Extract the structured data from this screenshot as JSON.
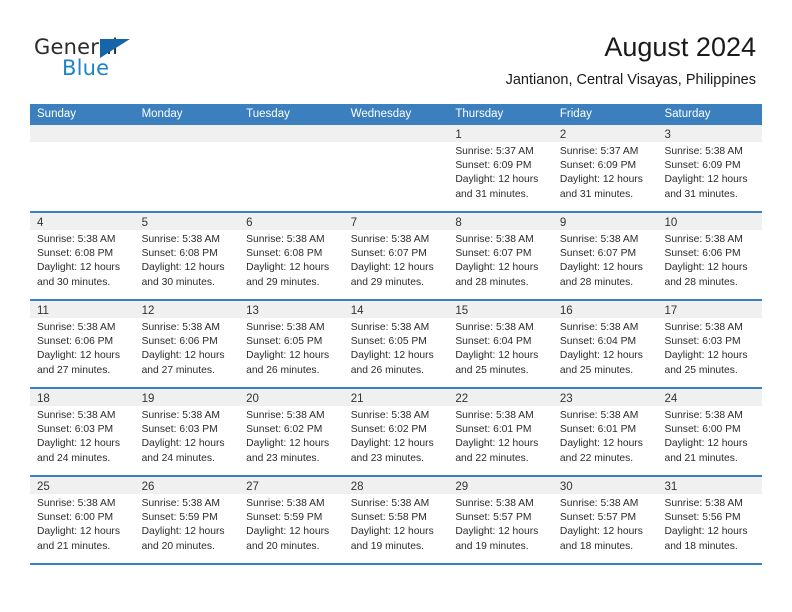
{
  "brand": {
    "name_part1": "General",
    "name_part2": "Blue",
    "triangle_color": "#1565a8",
    "blue_text_color": "#2083c8"
  },
  "header": {
    "title": "August 2024",
    "subtitle": "Jantianon, Central Visayas, Philippines"
  },
  "theme": {
    "header_row_bg": "#3b7fbf",
    "header_row_text": "#ffffff",
    "day_band_bg": "#f0f0f0",
    "week_divider": "#3b7fbf",
    "cell_bg": "#ffffff",
    "body_text": "#2b2b2b"
  },
  "weekdays": [
    "Sunday",
    "Monday",
    "Tuesday",
    "Wednesday",
    "Thursday",
    "Friday",
    "Saturday"
  ],
  "weeks": [
    [
      {
        "day": "",
        "sunrise": "",
        "sunset": "",
        "daylight_line1": "",
        "daylight_line2": ""
      },
      {
        "day": "",
        "sunrise": "",
        "sunset": "",
        "daylight_line1": "",
        "daylight_line2": ""
      },
      {
        "day": "",
        "sunrise": "",
        "sunset": "",
        "daylight_line1": "",
        "daylight_line2": ""
      },
      {
        "day": "",
        "sunrise": "",
        "sunset": "",
        "daylight_line1": "",
        "daylight_line2": ""
      },
      {
        "day": "1",
        "sunrise": "Sunrise: 5:37 AM",
        "sunset": "Sunset: 6:09 PM",
        "daylight_line1": "Daylight: 12 hours",
        "daylight_line2": "and 31 minutes."
      },
      {
        "day": "2",
        "sunrise": "Sunrise: 5:37 AM",
        "sunset": "Sunset: 6:09 PM",
        "daylight_line1": "Daylight: 12 hours",
        "daylight_line2": "and 31 minutes."
      },
      {
        "day": "3",
        "sunrise": "Sunrise: 5:38 AM",
        "sunset": "Sunset: 6:09 PM",
        "daylight_line1": "Daylight: 12 hours",
        "daylight_line2": "and 31 minutes."
      }
    ],
    [
      {
        "day": "4",
        "sunrise": "Sunrise: 5:38 AM",
        "sunset": "Sunset: 6:08 PM",
        "daylight_line1": "Daylight: 12 hours",
        "daylight_line2": "and 30 minutes."
      },
      {
        "day": "5",
        "sunrise": "Sunrise: 5:38 AM",
        "sunset": "Sunset: 6:08 PM",
        "daylight_line1": "Daylight: 12 hours",
        "daylight_line2": "and 30 minutes."
      },
      {
        "day": "6",
        "sunrise": "Sunrise: 5:38 AM",
        "sunset": "Sunset: 6:08 PM",
        "daylight_line1": "Daylight: 12 hours",
        "daylight_line2": "and 29 minutes."
      },
      {
        "day": "7",
        "sunrise": "Sunrise: 5:38 AM",
        "sunset": "Sunset: 6:07 PM",
        "daylight_line1": "Daylight: 12 hours",
        "daylight_line2": "and 29 minutes."
      },
      {
        "day": "8",
        "sunrise": "Sunrise: 5:38 AM",
        "sunset": "Sunset: 6:07 PM",
        "daylight_line1": "Daylight: 12 hours",
        "daylight_line2": "and 28 minutes."
      },
      {
        "day": "9",
        "sunrise": "Sunrise: 5:38 AM",
        "sunset": "Sunset: 6:07 PM",
        "daylight_line1": "Daylight: 12 hours",
        "daylight_line2": "and 28 minutes."
      },
      {
        "day": "10",
        "sunrise": "Sunrise: 5:38 AM",
        "sunset": "Sunset: 6:06 PM",
        "daylight_line1": "Daylight: 12 hours",
        "daylight_line2": "and 28 minutes."
      }
    ],
    [
      {
        "day": "11",
        "sunrise": "Sunrise: 5:38 AM",
        "sunset": "Sunset: 6:06 PM",
        "daylight_line1": "Daylight: 12 hours",
        "daylight_line2": "and 27 minutes."
      },
      {
        "day": "12",
        "sunrise": "Sunrise: 5:38 AM",
        "sunset": "Sunset: 6:06 PM",
        "daylight_line1": "Daylight: 12 hours",
        "daylight_line2": "and 27 minutes."
      },
      {
        "day": "13",
        "sunrise": "Sunrise: 5:38 AM",
        "sunset": "Sunset: 6:05 PM",
        "daylight_line1": "Daylight: 12 hours",
        "daylight_line2": "and 26 minutes."
      },
      {
        "day": "14",
        "sunrise": "Sunrise: 5:38 AM",
        "sunset": "Sunset: 6:05 PM",
        "daylight_line1": "Daylight: 12 hours",
        "daylight_line2": "and 26 minutes."
      },
      {
        "day": "15",
        "sunrise": "Sunrise: 5:38 AM",
        "sunset": "Sunset: 6:04 PM",
        "daylight_line1": "Daylight: 12 hours",
        "daylight_line2": "and 25 minutes."
      },
      {
        "day": "16",
        "sunrise": "Sunrise: 5:38 AM",
        "sunset": "Sunset: 6:04 PM",
        "daylight_line1": "Daylight: 12 hours",
        "daylight_line2": "and 25 minutes."
      },
      {
        "day": "17",
        "sunrise": "Sunrise: 5:38 AM",
        "sunset": "Sunset: 6:03 PM",
        "daylight_line1": "Daylight: 12 hours",
        "daylight_line2": "and 25 minutes."
      }
    ],
    [
      {
        "day": "18",
        "sunrise": "Sunrise: 5:38 AM",
        "sunset": "Sunset: 6:03 PM",
        "daylight_line1": "Daylight: 12 hours",
        "daylight_line2": "and 24 minutes."
      },
      {
        "day": "19",
        "sunrise": "Sunrise: 5:38 AM",
        "sunset": "Sunset: 6:03 PM",
        "daylight_line1": "Daylight: 12 hours",
        "daylight_line2": "and 24 minutes."
      },
      {
        "day": "20",
        "sunrise": "Sunrise: 5:38 AM",
        "sunset": "Sunset: 6:02 PM",
        "daylight_line1": "Daylight: 12 hours",
        "daylight_line2": "and 23 minutes."
      },
      {
        "day": "21",
        "sunrise": "Sunrise: 5:38 AM",
        "sunset": "Sunset: 6:02 PM",
        "daylight_line1": "Daylight: 12 hours",
        "daylight_line2": "and 23 minutes."
      },
      {
        "day": "22",
        "sunrise": "Sunrise: 5:38 AM",
        "sunset": "Sunset: 6:01 PM",
        "daylight_line1": "Daylight: 12 hours",
        "daylight_line2": "and 22 minutes."
      },
      {
        "day": "23",
        "sunrise": "Sunrise: 5:38 AM",
        "sunset": "Sunset: 6:01 PM",
        "daylight_line1": "Daylight: 12 hours",
        "daylight_line2": "and 22 minutes."
      },
      {
        "day": "24",
        "sunrise": "Sunrise: 5:38 AM",
        "sunset": "Sunset: 6:00 PM",
        "daylight_line1": "Daylight: 12 hours",
        "daylight_line2": "and 21 minutes."
      }
    ],
    [
      {
        "day": "25",
        "sunrise": "Sunrise: 5:38 AM",
        "sunset": "Sunset: 6:00 PM",
        "daylight_line1": "Daylight: 12 hours",
        "daylight_line2": "and 21 minutes."
      },
      {
        "day": "26",
        "sunrise": "Sunrise: 5:38 AM",
        "sunset": "Sunset: 5:59 PM",
        "daylight_line1": "Daylight: 12 hours",
        "daylight_line2": "and 20 minutes."
      },
      {
        "day": "27",
        "sunrise": "Sunrise: 5:38 AM",
        "sunset": "Sunset: 5:59 PM",
        "daylight_line1": "Daylight: 12 hours",
        "daylight_line2": "and 20 minutes."
      },
      {
        "day": "28",
        "sunrise": "Sunrise: 5:38 AM",
        "sunset": "Sunset: 5:58 PM",
        "daylight_line1": "Daylight: 12 hours",
        "daylight_line2": "and 19 minutes."
      },
      {
        "day": "29",
        "sunrise": "Sunrise: 5:38 AM",
        "sunset": "Sunset: 5:57 PM",
        "daylight_line1": "Daylight: 12 hours",
        "daylight_line2": "and 19 minutes."
      },
      {
        "day": "30",
        "sunrise": "Sunrise: 5:38 AM",
        "sunset": "Sunset: 5:57 PM",
        "daylight_line1": "Daylight: 12 hours",
        "daylight_line2": "and 18 minutes."
      },
      {
        "day": "31",
        "sunrise": "Sunrise: 5:38 AM",
        "sunset": "Sunset: 5:56 PM",
        "daylight_line1": "Daylight: 12 hours",
        "daylight_line2": "and 18 minutes."
      }
    ]
  ]
}
